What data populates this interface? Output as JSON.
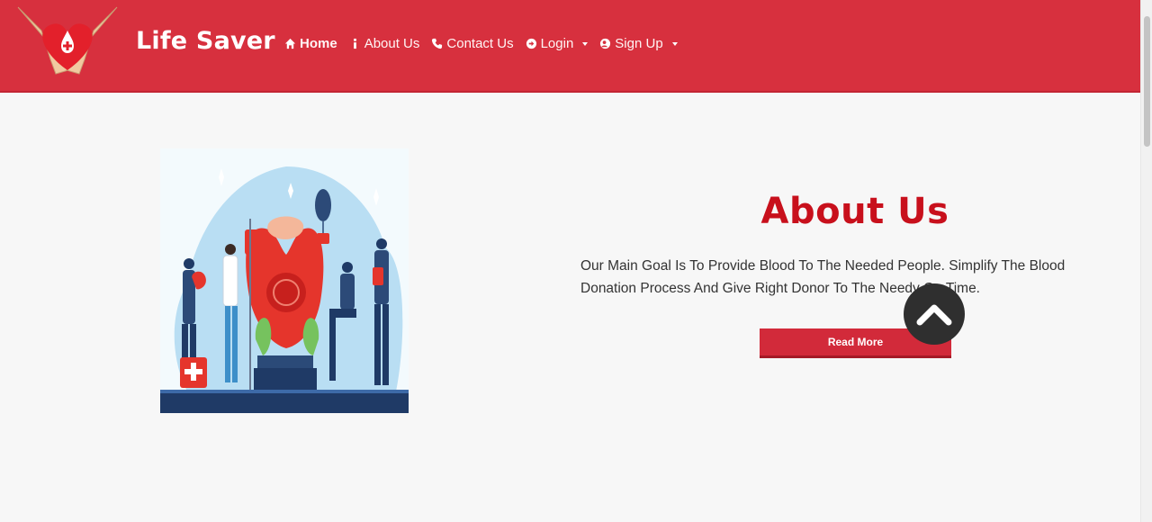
{
  "header": {
    "brand": "Life Saver",
    "nav": [
      {
        "label": "Home",
        "icon": "home-icon"
      },
      {
        "label": "About Us",
        "icon": "info-icon"
      },
      {
        "label": "Contact Us",
        "icon": "phone-icon"
      },
      {
        "label": "Login",
        "icon": "sign-in-icon"
      },
      {
        "label": "Sign Up",
        "icon": "user-plus-icon"
      }
    ]
  },
  "about": {
    "title": "About Us",
    "text": "Our Main Goal Is To Provide Blood To The Needed People. Simplify The Blood Donation Process And Give Right Donor To The Needy On Time.",
    "button": "Read More"
  },
  "colors": {
    "brand_red": "#d7303e",
    "title_red": "#c8101c",
    "back_to_top": "#2f2f2f"
  }
}
